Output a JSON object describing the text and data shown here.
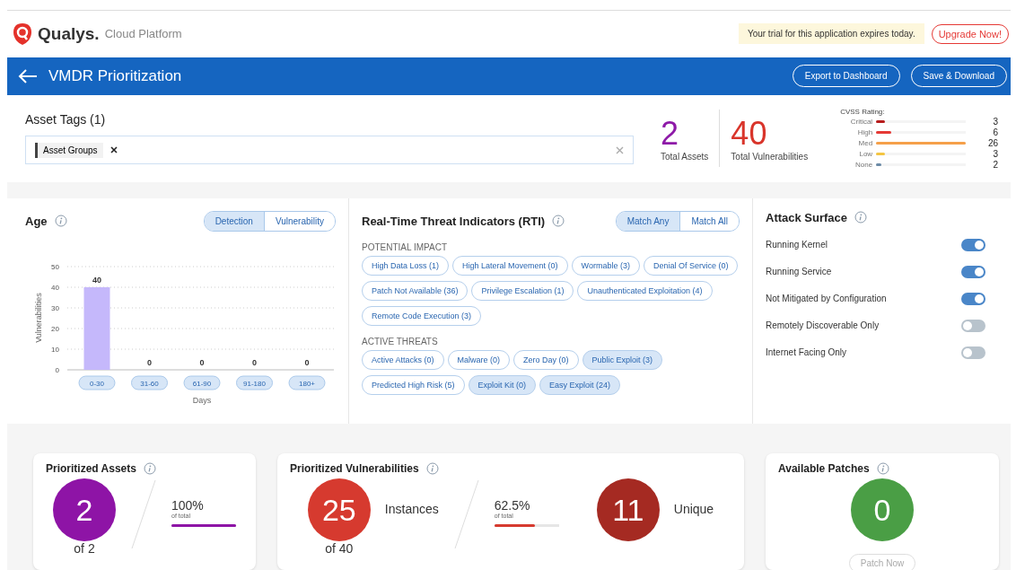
{
  "brand": {
    "name": "Qualys.",
    "product": "Cloud Platform"
  },
  "trial": {
    "notice": "Your trial for this application expires today.",
    "button": "Upgrade Now!"
  },
  "titlebar": {
    "title": "VMDR Prioritization",
    "buttons": [
      "Export to Dashboard",
      "Save & Download"
    ]
  },
  "asset_tags": {
    "title": "Asset Tags (1)",
    "tags": [
      "Asset Groups"
    ]
  },
  "totals": [
    {
      "value": "2",
      "label": "Total Assets",
      "color": "#8e1aa8"
    },
    {
      "value": "40",
      "label": "Total Vulnerabilities",
      "color": "#d9352b"
    }
  ],
  "cvss": {
    "title": "CVSS Rating:",
    "rows": [
      {
        "name": "Critical",
        "count": "3",
        "level": 0.1,
        "color": "#b71c1c"
      },
      {
        "name": "High",
        "count": "6",
        "level": 0.17,
        "color": "#e53935"
      },
      {
        "name": "Med",
        "count": "26",
        "level": 1,
        "color": "#f5a04a"
      },
      {
        "name": "Low",
        "count": "3",
        "level": 0.1,
        "color": "#f4c542"
      },
      {
        "name": "None",
        "count": "2",
        "level": 0.06,
        "color": "#6b8aa6"
      }
    ]
  },
  "age": {
    "title": "Age",
    "toggle": [
      {
        "label": "Detection",
        "selected": true
      },
      {
        "label": "Vulnerability",
        "selected": false
      }
    ],
    "chart_data": {
      "type": "bar",
      "xlabel": "Days",
      "ylabel": "Vulnerabilities",
      "categories": [
        "0-30",
        "31-60",
        "61-90",
        "91-180",
        "180+"
      ],
      "values": [
        40,
        0,
        0,
        0,
        0
      ],
      "yticks": [
        0,
        10,
        20,
        30,
        40,
        50
      ],
      "ylim": [
        0,
        50
      ],
      "data_labels": true,
      "grid": true
    }
  },
  "rti": {
    "title": "Real-Time Threat Indicators (RTI)",
    "toggle": [
      {
        "label": "Match Any",
        "selected": true
      },
      {
        "label": "Match All",
        "selected": false
      }
    ],
    "groups": [
      {
        "title": "POTENTIAL IMPACT",
        "chips": [
          {
            "label": "High Data Loss (1)",
            "selected": false
          },
          {
            "label": "High Lateral Movement (0)",
            "selected": false
          },
          {
            "label": "Wormable (3)",
            "selected": false
          },
          {
            "label": "Denial Of Service (0)",
            "selected": false
          },
          {
            "label": "Patch Not Available (36)",
            "selected": false
          },
          {
            "label": "Privilege Escalation (1)",
            "selected": false
          },
          {
            "label": "Unauthenticated Exploitation (4)",
            "selected": false
          },
          {
            "label": "Remote Code Execution (3)",
            "selected": false
          }
        ]
      },
      {
        "title": "ACTIVE THREATS",
        "chips": [
          {
            "label": "Active Attacks (0)",
            "selected": false
          },
          {
            "label": "Malware (0)",
            "selected": false
          },
          {
            "label": "Zero Day (0)",
            "selected": false
          },
          {
            "label": "Public Exploit (3)",
            "selected": true
          },
          {
            "label": "Predicted High Risk (5)",
            "selected": false
          },
          {
            "label": "Exploit Kit (0)",
            "selected": true
          },
          {
            "label": "Easy Exploit (24)",
            "selected": true
          }
        ]
      }
    ]
  },
  "attack_surface": {
    "title": "Attack Surface",
    "items": [
      {
        "label": "Running Kernel",
        "on": true
      },
      {
        "label": "Running Service",
        "on": true
      },
      {
        "label": "Not Mitigated by Configuration",
        "on": true
      },
      {
        "label": "Remotely Discoverable Only",
        "on": false
      },
      {
        "label": "Internet Facing Only",
        "on": false
      }
    ]
  },
  "cards": [
    {
      "kind": "assets",
      "title": "Prioritized Assets",
      "circles": [
        {
          "value": "2",
          "sub": "of 2",
          "color": "#8e14a6"
        }
      ],
      "percent": "100%",
      "percent_sub": "of total",
      "level": 1
    },
    {
      "kind": "vulns",
      "title": "Prioritized Vulnerabilities",
      "circles": [
        {
          "value": "25",
          "label": "Instances",
          "sub": "of 40",
          "color": "#d63a2f"
        },
        {
          "value": "11",
          "label": "Unique",
          "color": "#a52a22"
        }
      ],
      "percent": "62.5%",
      "percent_sub": "of total",
      "level": 0.625
    },
    {
      "kind": "patches",
      "title": "Available Patches",
      "circles": [
        {
          "value": "0",
          "color": "#4a9e45"
        }
      ],
      "button": {
        "label": "Patch Now",
        "disabled": true
      }
    }
  ]
}
